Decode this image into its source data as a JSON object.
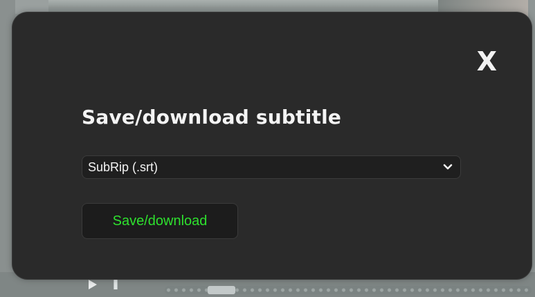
{
  "modal": {
    "close_label": "X",
    "title": "Save/download subtitle",
    "format_select": {
      "selected_value": "SubRip (.srt)",
      "icon": "chevron-down-icon"
    },
    "save_button_label": "Save/download"
  },
  "colors": {
    "modal_background": "#2a2a2a",
    "text": "#f4f4f4",
    "save_button_text": "#2ee02e",
    "backdrop": "#8f9695"
  },
  "background_player": {
    "icons": [
      "play-icon",
      "pause-icon"
    ]
  }
}
